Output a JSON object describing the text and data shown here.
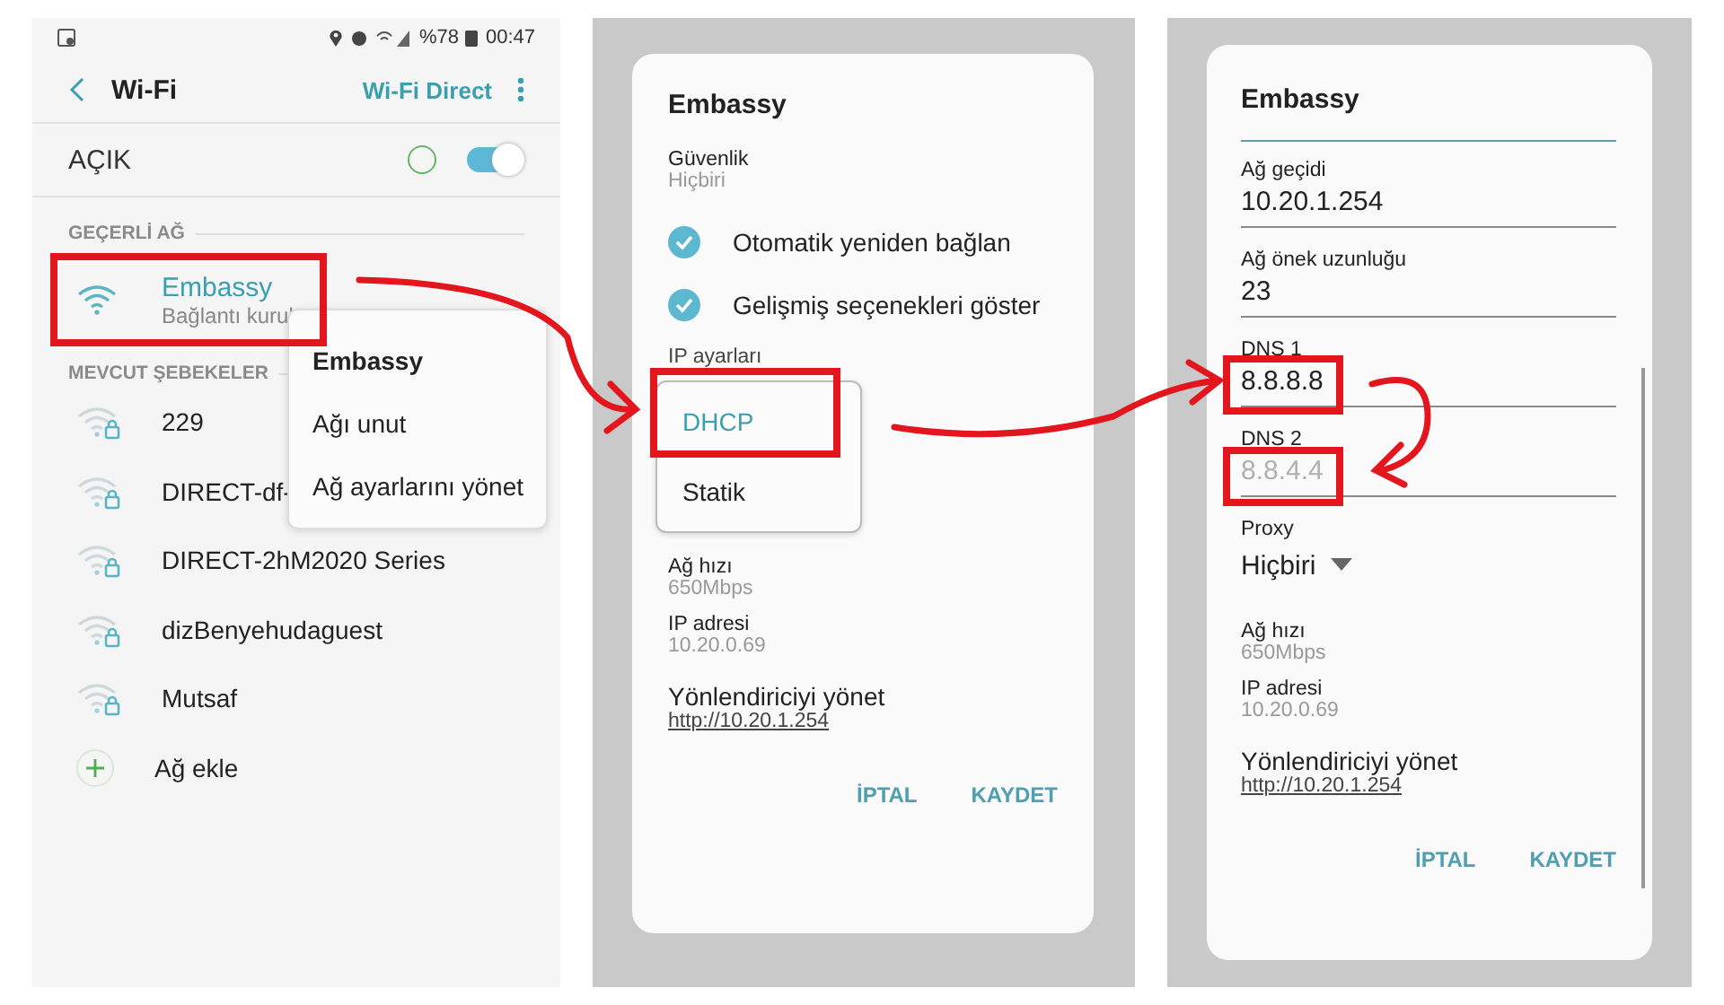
{
  "wifi_screen": {
    "status_bar": {
      "battery": "%78",
      "time": "00:47"
    },
    "header": {
      "title": "Wi-Fi",
      "action": "Wi-Fi Direct"
    },
    "master": {
      "label": "AÇIK",
      "on": true
    },
    "current_section": "GEÇERLİ AĞ",
    "current": {
      "name": "Embassy",
      "status": "Bağlantı kurul"
    },
    "available_section": "MEVCUT ŞEBEKELER",
    "networks": [
      {
        "name": "229",
        "locked": true
      },
      {
        "name": "DIRECT-df-",
        "locked": true
      },
      {
        "name": "DIRECT-2hM2020 Series",
        "locked": true
      },
      {
        "name": "dizBenyehudaguest",
        "locked": true
      },
      {
        "name": "Mutsaf",
        "locked": true
      }
    ],
    "add_network": "Ağ ekle",
    "context_menu": {
      "title": "Embassy",
      "items": [
        "Ağı unut",
        "Ağ ayarlarını yönet"
      ]
    }
  },
  "dhcp_dialog": {
    "title": "Embassy",
    "security_label": "Güvenlik",
    "security_value": "Hiçbiri",
    "options": [
      {
        "label": "Otomatik yeniden bağlan",
        "checked": true
      },
      {
        "label": "Gelişmiş seçenekleri göster",
        "checked": true
      }
    ],
    "ip_settings_label": "IP ayarları",
    "ip_menu": [
      {
        "label": "DHCP",
        "selected": true
      },
      {
        "label": "Statik",
        "selected": false
      }
    ],
    "info": [
      {
        "label": "Ağ hızı",
        "value": "650Mbps"
      },
      {
        "label": "IP adresi",
        "value": "10.20.0.69"
      }
    ],
    "router": {
      "label": "Yönlendiriciyi yönet",
      "link": "http://10.20.1.254"
    },
    "buttons": [
      "İPTAL",
      "KAYDET"
    ]
  },
  "static_dialog": {
    "title": "Embassy",
    "fields": [
      {
        "kind": "field",
        "label": "Ağ geçidi",
        "value": "10.20.1.254"
      },
      {
        "kind": "field",
        "label": "Ağ önek uzunluğu",
        "value": "23"
      },
      {
        "kind": "field",
        "label": "DNS 1",
        "value": "8.8.8.8"
      },
      {
        "kind": "field",
        "label": "DNS 2",
        "placeholder": "8.8.4.4"
      },
      {
        "kind": "dropdown",
        "label": "Proxy",
        "value": "Hiçbiri"
      }
    ],
    "info": [
      {
        "label": "Ağ hızı",
        "value": "650Mbps"
      },
      {
        "label": "IP adresi",
        "value": "10.20.0.69"
      }
    ],
    "router": {
      "label": "Yönlendiriciyi yönet",
      "link": "http://10.20.1.254"
    },
    "buttons": [
      "İPTAL",
      "KAYDET"
    ]
  }
}
